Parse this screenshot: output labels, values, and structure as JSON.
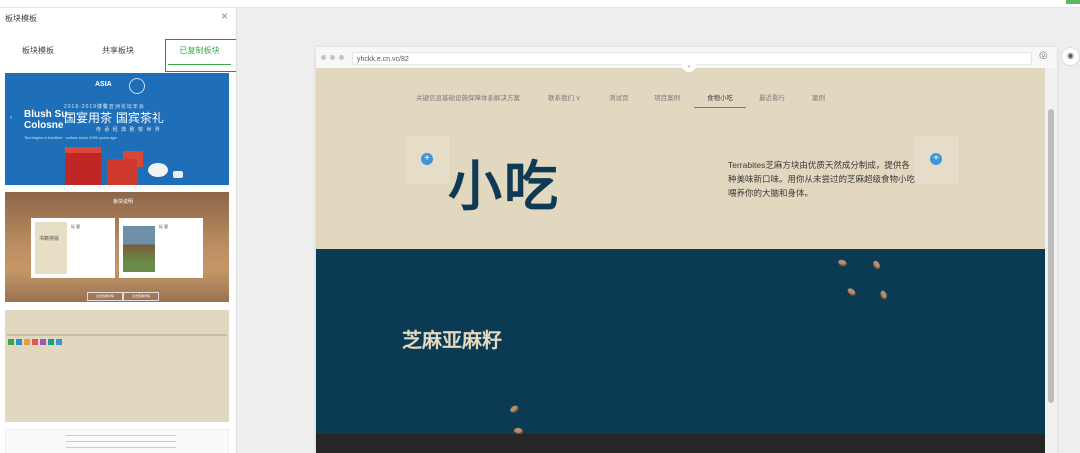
{
  "panel": {
    "title": "板块模板",
    "close_glyph": "×",
    "tabs": [
      "板块模板",
      "共享板块",
      "已复制板块"
    ],
    "active_tab": "已复制板块",
    "thumbs": {
      "t1": {
        "logo": "ASIA",
        "brand": "Blush Su\nColosne",
        "subtitle": "2018-2019博鳌亚洲论坛年会",
        "calligraphy": "国宴用茶  国宾茶礼",
        "sub2": "传 承 经 典      致 敬 世 界",
        "tiny": "Tea begins a tradition · culture since 2000 years ago"
      },
      "t2": {
        "header": "板块说明",
        "book_text": "书籍排版",
        "card1_text": "标 题",
        "card2_text": "标 题",
        "btn1": "点击查看详情",
        "btn2": "点击查看详情"
      }
    }
  },
  "browser": {
    "url": "yhckk.e.cn.vc/82",
    "globe_icon": "◎",
    "eye_icon": "◉"
  },
  "site": {
    "nav": [
      "关键信息基础设施保障体系解决方案",
      "联系我们 ∨",
      "测试页",
      "项目案例",
      "食物小吃",
      "最近看行",
      "案例"
    ],
    "active_nav": "食物小吃",
    "hero_title": "小吃",
    "hero_desc": "Terrabites芝麻方块由优质天然成分制成，提供各种美味新口味。用你从未尝过的芝麻超级食物小吃喂养你的大脑和身体。",
    "section_title": "芝麻亚麻籽",
    "plus_glyph": "+"
  },
  "colors": {
    "accent_green": "#3aa848",
    "highlight_red": "#e8312b",
    "hero_bg": "#e2d8bf",
    "dark_bg": "#0b3a53",
    "plus_blue": "#3d97d6"
  }
}
